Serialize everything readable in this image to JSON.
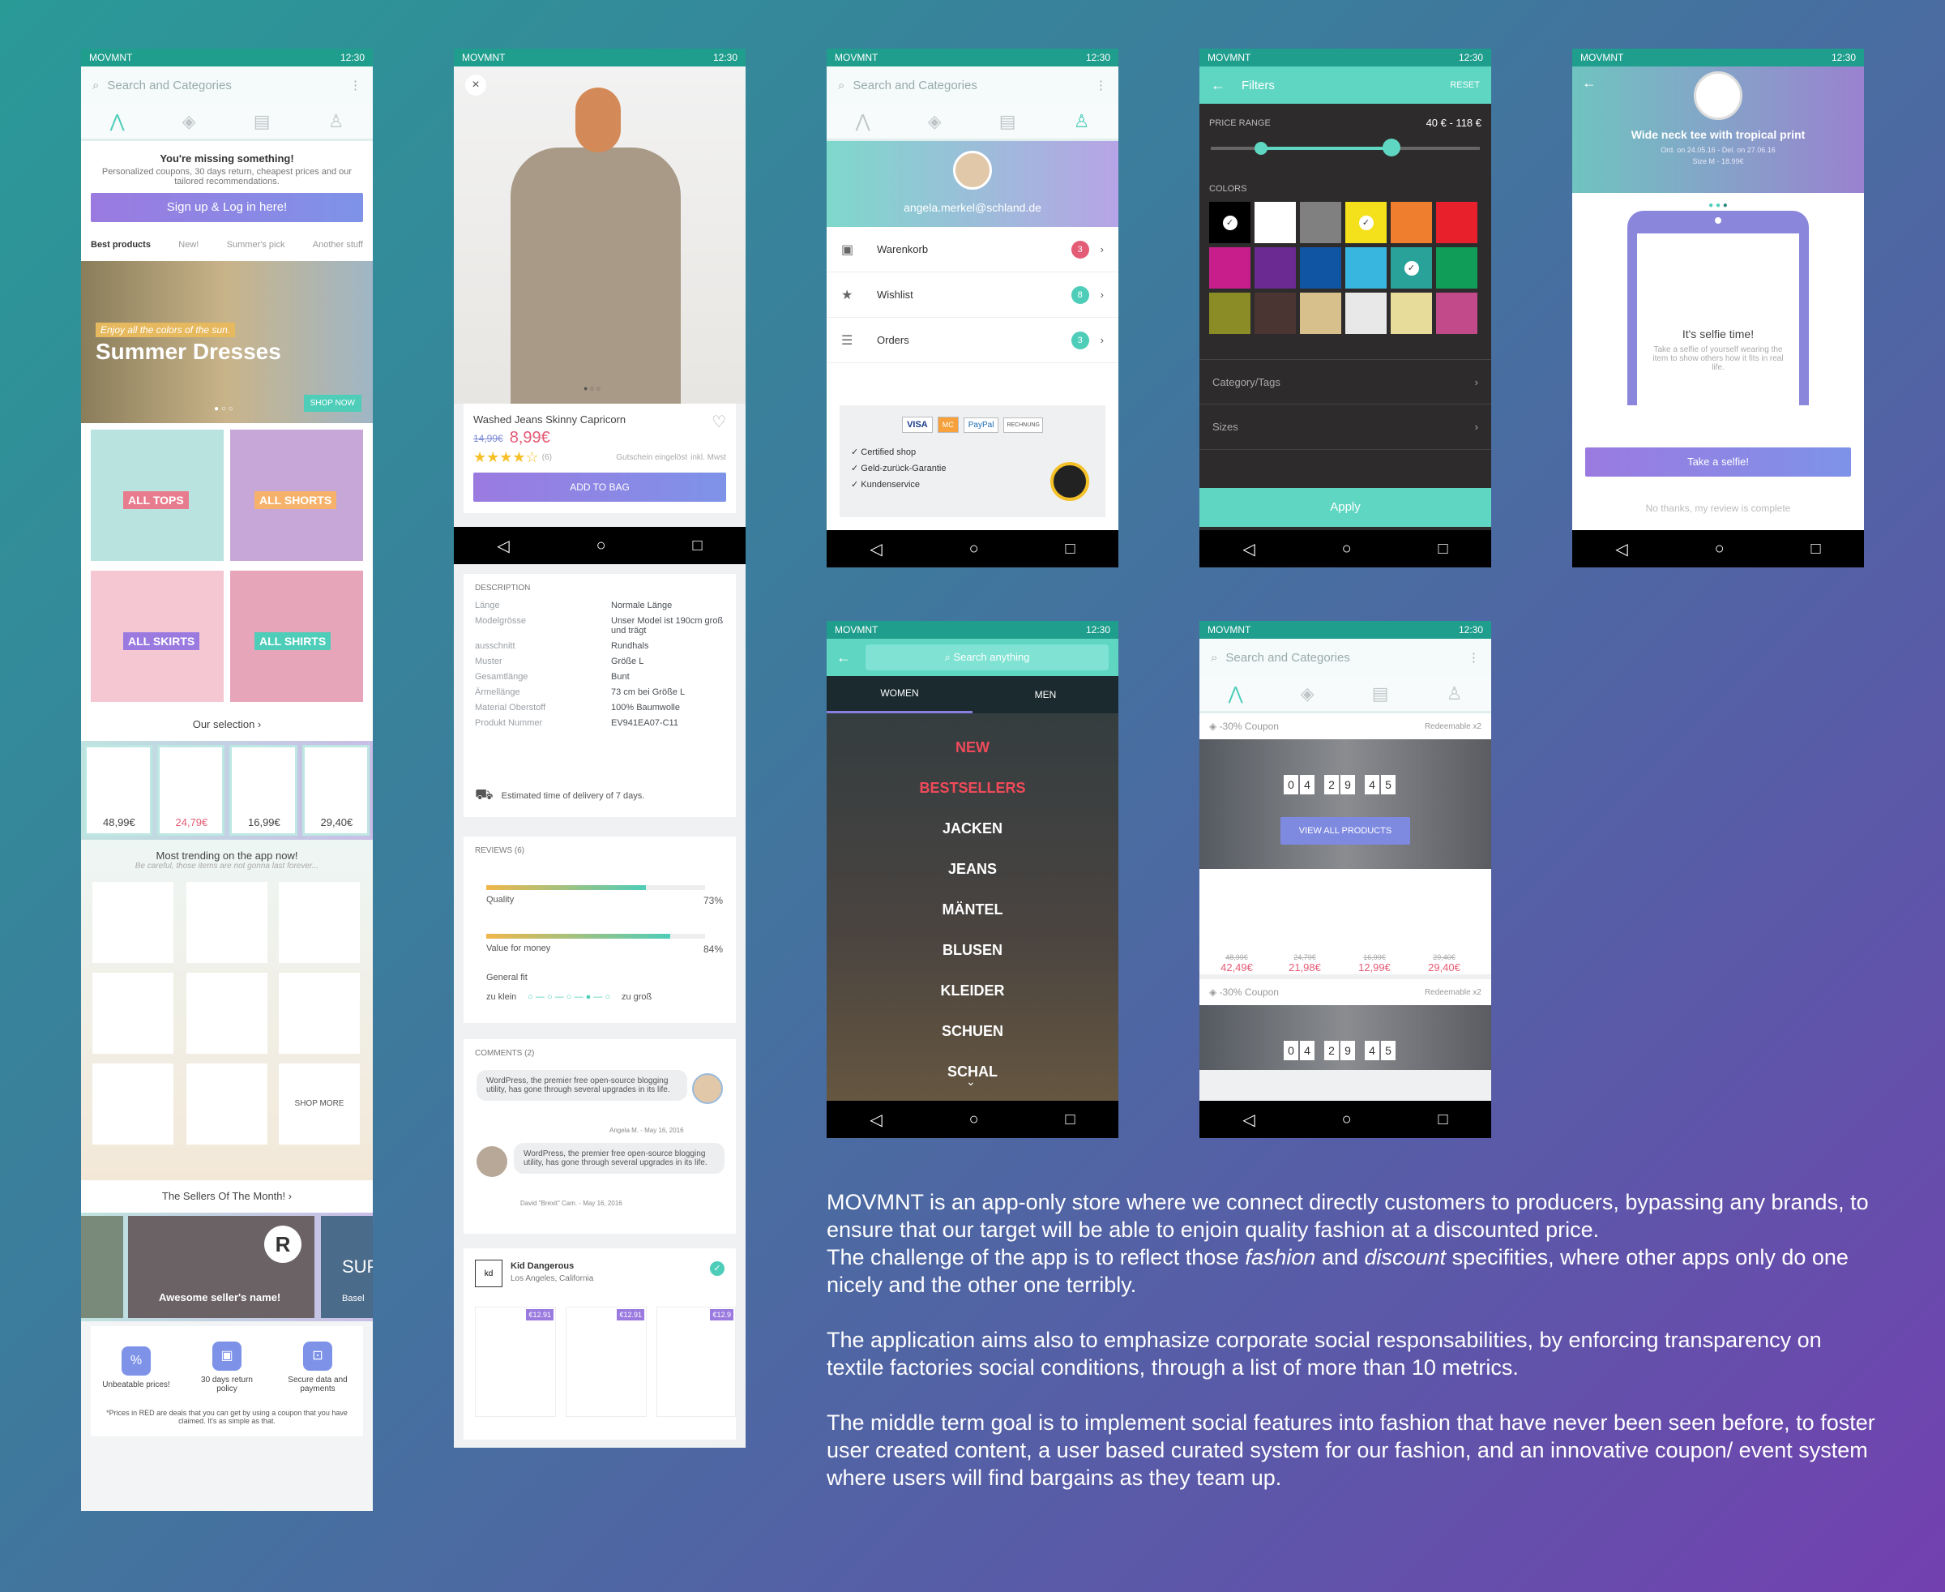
{
  "status": {
    "app": "MOVMNT",
    "time": "12:30"
  },
  "screen1": {
    "search_placeholder": "Search and Categories",
    "promo_title": "You're missing something!",
    "promo_text": "Personalized coupons, 30 days return, cheapest prices and our tailored recommendations.",
    "signup": "Sign up & Log in here!",
    "tabs": [
      "Best products",
      "New!",
      "Summer's pick",
      "Another stuff"
    ],
    "banner_sub": "Enjoy all the colors of the sun.",
    "banner_title": "Summer Dresses",
    "shop_now": "SHOP NOW",
    "categories": [
      "ALL TOPS",
      "ALL SHORTS",
      "ALL SKIRTS",
      "ALL SHIRTS"
    ],
    "our_selection": "Our selection",
    "selection_prices": [
      "48,99€",
      "24,79€",
      "16,99€",
      "29,40€"
    ],
    "trending_title": "Most trending on the app now!",
    "trending_sub": "Be careful, those items are not gonna last forever...",
    "shop_more": "SHOP MORE",
    "sellers_title": "The Sellers Of The Month!",
    "seller_name": "Awesome seller's name!",
    "seller2": "SUP",
    "seller2_sub": "Basel",
    "features": [
      "Unbeatable prices!",
      "30 days return policy",
      "Secure data and payments"
    ],
    "footnote": "*Prices in RED are deals that you can get by using a coupon that you have claimed. It's as simple as that."
  },
  "screen2": {
    "product": "Washed Jeans Skinny Capricorn",
    "old_price": "14,99€",
    "new_price": "8,99€",
    "rating_count": "(6)",
    "coupon_note": "Gutschein eingelöst",
    "tax_note": "inkl. Mwst",
    "add_to_bag": "ADD TO BAG",
    "desc_title": "DESCRIPTION",
    "specs": [
      [
        "Länge",
        "Normale Länge"
      ],
      [
        "Modelgrösse",
        "Unser Model ist 190cm groß und trägt"
      ],
      [
        "ausschnitt",
        "Rundhals"
      ],
      [
        "Muster",
        "Größe L"
      ],
      [
        "Gesamtlänge",
        "Bunt"
      ],
      [
        "Ärmellänge",
        "73 cm bei Größe L"
      ],
      [
        "Material Oberstoff",
        "100% Baumwolle"
      ],
      [
        "Produkt Nummer",
        "EV941EA07-C11"
      ]
    ],
    "delivery": "Estimated time of delivery of 7 days.",
    "reviews_title": "REVIEWS (6)",
    "quality": "Quality",
    "quality_pct": "73%",
    "quality_val": 0.73,
    "value": "Value for money",
    "value_pct": "84%",
    "value_val": 0.84,
    "fit": "General fit",
    "fit_small": "zu klein",
    "fit_big": "zu groß",
    "comments_title": "COMMENTS (2)",
    "comment": "WordPress, the premier free open-source blogging utility, has gone through several upgrades in its life.",
    "comment1_author": "Angela M. - May 16, 2016",
    "comment2_author": "David \"Brexit\" Cam. - May 16, 2016",
    "seller": "Kid Dangerous",
    "seller_loc": "Los Angeles, California",
    "seller_prices": [
      "€12.91",
      "€12.91",
      "€12.9"
    ]
  },
  "screen3": {
    "search_placeholder": "Search and Categories",
    "email": "angela.merkel@schland.de",
    "items": [
      {
        "label": "Warenkorb",
        "count": "3",
        "color": "#e45b75"
      },
      {
        "label": "Wishlist",
        "count": "8",
        "color": "#4ecdb9"
      },
      {
        "label": "Orders",
        "count": "3",
        "color": "#4ecdb9"
      }
    ],
    "payments": [
      "VISA",
      "MC",
      "PayPal",
      "RECHNUNG"
    ],
    "checks": [
      "Certified shop",
      "Geld-zurück-Garantie",
      "Kundenservice"
    ]
  },
  "screen4": {
    "title": "Filters",
    "reset": "RESET",
    "price_label": "PRICE RANGE",
    "price_value": "40 € - 118 €",
    "colors_label": "COLORS",
    "colors": [
      "#000000",
      "#ffffff",
      "#808080",
      "#f4e11c",
      "#ef7e2e",
      "#e8202c",
      "#c71e8c",
      "#6a2a92",
      "#1054a4",
      "#38b6e0",
      "#29a39a",
      "#0f9d57",
      "#8b8c25",
      "#4a3532",
      "#d8c08c",
      "#e8e8e8",
      "#e8dc9a",
      "#c24a8a"
    ],
    "category": "Category/Tags",
    "sizes": "Sizes",
    "apply": "Apply"
  },
  "screen5": {
    "title": "Wide neck tee with tropical print",
    "order": "Ord. on 24.05.16 - Del. on 27.06.16",
    "size": "Size M - 18.99€",
    "selfie_title": "It's selfie time!",
    "selfie_text": "Take a selfie of yourself wearing the item to show others how it fits in real life.",
    "cta": "Take a selfie!",
    "skip": "No thanks, my review is complete"
  },
  "screen6": {
    "search": "Search anything",
    "tabs": [
      "WOMEN",
      "MEN"
    ],
    "menu": [
      {
        "label": "NEW",
        "color": "#f04a5a"
      },
      {
        "label": "BESTSELLERS",
        "color": "#f04a5a"
      },
      {
        "label": "JACKEN",
        "color": "#ffffff"
      },
      {
        "label": "JEANS",
        "color": "#ffffff"
      },
      {
        "label": "MÄNTEL",
        "color": "#ffffff"
      },
      {
        "label": "BLUSEN",
        "color": "#ffffff"
      },
      {
        "label": "KLEIDER",
        "color": "#ffffff"
      },
      {
        "label": "SCHUEN",
        "color": "#ffffff"
      },
      {
        "label": "SCHAL",
        "color": "#ffffff"
      }
    ]
  },
  "screen7": {
    "search_placeholder": "Search and Categories",
    "coupon": "-30% Coupon",
    "redeemable": "Redeemable x2",
    "timer": [
      "0",
      "4",
      "2",
      "9",
      "4",
      "5"
    ],
    "view_all": "VIEW ALL PRODUCTS",
    "old_prices": [
      "48,99€",
      "24,79€",
      "16,99€",
      "29,40€"
    ],
    "new_prices": [
      "42,49€",
      "21,98€",
      "12,99€",
      "29,40€"
    ]
  },
  "description": {
    "p1a": "MOVMNT is an app-only store where we connect directly customers to producers, bypassing any brands, to ensure that our target will be able to enjoin quality fashion at a discounted price.",
    "p1b": "The challenge of the app is to reflect those",
    "p1_fashion": "fashion",
    "p1_and": "and",
    "p1_discount": "discount",
    "p1c": "specifities, where other apps only do one nicely and the other one terribly.",
    "p2": "The application aims also to emphasize corporate social responsabilities, by enforcing transparency on textile factories social conditions, through a list of more than 10 metrics.",
    "p3": "The middle term goal is to implement social features into fashion that have never been seen before, to foster user created content, a user based curated system for our fashion, and an innovative coupon/ event system where users will find bargains as they team up."
  }
}
